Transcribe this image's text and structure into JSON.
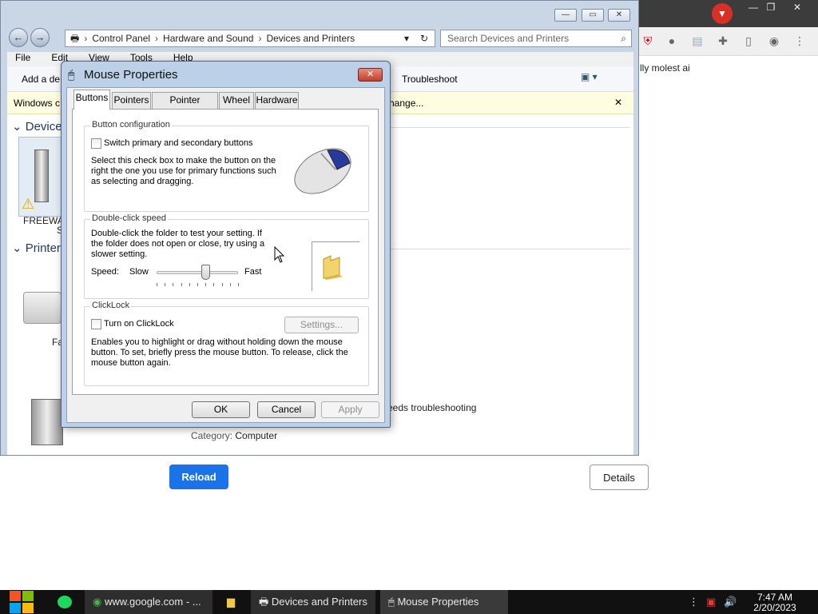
{
  "browser": {
    "body_text": "lly molest ai",
    "buttons": {
      "reload": "Reload",
      "details": "Details"
    },
    "ext_icons": [
      "ublock-icon",
      "avatar-icon",
      "flag-icon",
      "puzzle-icon",
      "sidepanel-icon",
      "profile-icon",
      "menu-icon"
    ]
  },
  "explorer": {
    "breadcrumb": [
      "Control Panel",
      "Hardware and Sound",
      "Devices and Printers"
    ],
    "search_placeholder": "Search Devices and Printers",
    "menu": [
      "File",
      "Edit",
      "View",
      "Tools",
      "Help"
    ],
    "cmd": {
      "add_device": "Add a de",
      "troubleshoot": "Troubleshoot"
    },
    "infobar": {
      "left": "Windows c",
      "right": "hange..."
    },
    "groups": {
      "devices": "Device",
      "printers": "Printer"
    },
    "devices": {
      "freeware_1": "FREEWA",
      "freeware_2": "S",
      "fax": "Fa"
    },
    "status_text": "eeds troubleshooting",
    "category_label": "Category:",
    "category_value": "Computer"
  },
  "dialog": {
    "title": "Mouse Properties",
    "tabs": [
      "Buttons",
      "Pointers",
      "Pointer Options",
      "Wheel",
      "Hardware"
    ],
    "active_tab": "Buttons",
    "button_config": {
      "heading": "Button configuration",
      "checkbox_label": "Switch primary and secondary buttons",
      "checked": false,
      "description": "Select this check box to make the button on the right the one you use for primary functions such as selecting and dragging."
    },
    "double_click": {
      "heading": "Double-click speed",
      "description": "Double-click the folder to test your setting. If the folder does not open or close, try using a slower setting.",
      "speed_label": "Speed:",
      "slow": "Slow",
      "fast": "Fast",
      "slider_value": 0.6
    },
    "clicklock": {
      "heading": "ClickLock",
      "checkbox_label": "Turn on ClickLock",
      "checked": false,
      "settings_button": "Settings...",
      "description": "Enables you to highlight or drag without holding down the mouse button. To set, briefly press the mouse button. To release, click the mouse button again."
    },
    "buttons": {
      "ok": "OK",
      "cancel": "Cancel",
      "apply": "Apply"
    }
  },
  "taskbar": {
    "items": [
      {
        "label": "www.google.com - ..."
      },
      {
        "label": "Devices and Printers"
      },
      {
        "label": "Mouse Properties"
      }
    ],
    "time": "7:47 AM",
    "date": "2/20/2023"
  },
  "colors": {
    "accent_blue": "#1a73e8",
    "close_red": "#c2402c",
    "taskbar": "#111111"
  }
}
